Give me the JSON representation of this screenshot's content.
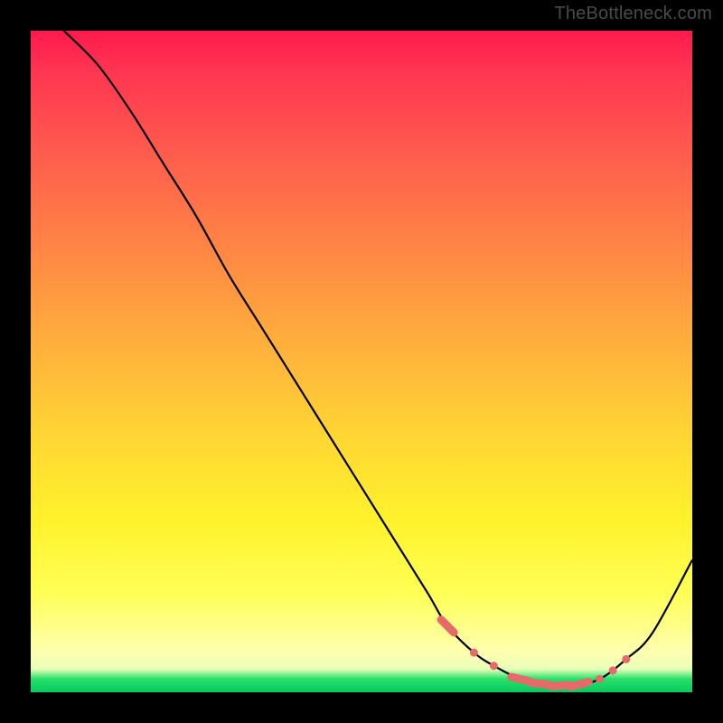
{
  "watermark": "TheBottleneck.com",
  "colors": {
    "frame": "#000000",
    "gradient_top": "#ff1a4d",
    "gradient_mid": "#ffd833",
    "gradient_bottom_green": "#08c95e",
    "curve": "#000000",
    "markers": "#e66a6a"
  },
  "chart_data": {
    "type": "line",
    "title": "",
    "xlabel": "",
    "ylabel": "",
    "xlim": [
      0,
      100
    ],
    "ylim": [
      0,
      100
    ],
    "series": [
      {
        "name": "bottleneck-curve",
        "x": [
          5,
          10,
          15,
          20,
          25,
          30,
          35,
          40,
          45,
          50,
          55,
          60,
          63,
          67,
          70,
          74,
          78,
          82,
          86,
          90,
          94,
          100
        ],
        "y": [
          100,
          95,
          88,
          80,
          72,
          63,
          55,
          47,
          39,
          31,
          23,
          15,
          10,
          6,
          4,
          2,
          1,
          1,
          2,
          5,
          9,
          20
        ]
      }
    ],
    "markers": {
      "name": "optimal-range-dots",
      "x": [
        63,
        67,
        70,
        74,
        77,
        80,
        83,
        86,
        88,
        90
      ],
      "y": [
        10,
        6,
        4,
        2,
        1.3,
        1,
        1.2,
        2,
        3.3,
        5
      ]
    }
  }
}
